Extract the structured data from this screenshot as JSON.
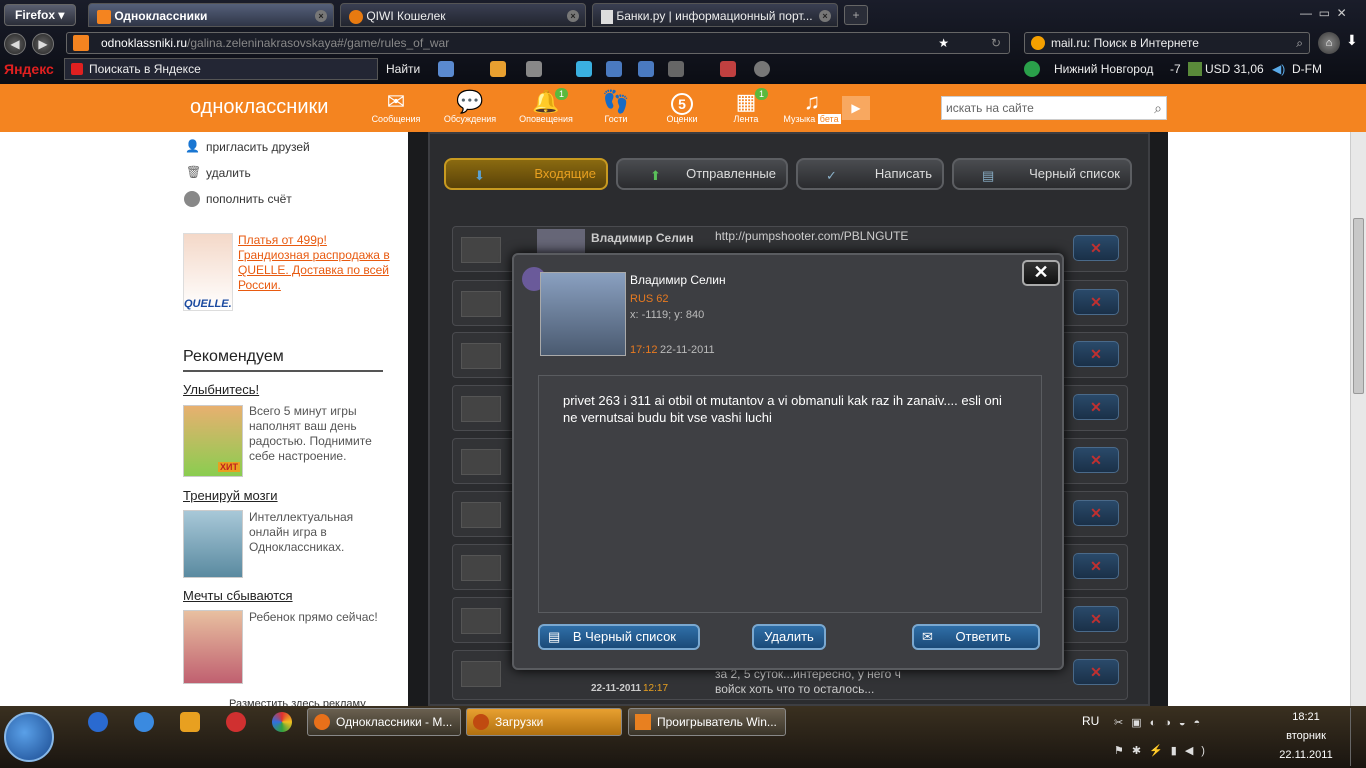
{
  "browser": {
    "firefox_label": "Firefox",
    "tabs": [
      {
        "label": "Одноклассники"
      },
      {
        "label": "QIWI Кошелек"
      },
      {
        "label": "Банки.ру | информационный порт..."
      }
    ],
    "url_domain": "odnoklassniki.ru",
    "url_path": "/galina.zeleninakrasovskaya#/game/rules_of_war",
    "search_text": "mail.ru: Поиск в Интернете",
    "yandex_logo": "Яндекс",
    "yandex_search": "Поискать в Яндексе",
    "find_label": "Найти",
    "city": "Нижний Новгород",
    "temp": "-7",
    "usd": "USD 31,06",
    "radio": "D-FM"
  },
  "site": {
    "logo": "одноклассники",
    "nav": [
      {
        "label": "Сообщения",
        "icon": "envelope-icon",
        "badge": ""
      },
      {
        "label": "Обсуждения",
        "icon": "chat-icon",
        "badge": ""
      },
      {
        "label": "Оповещения",
        "icon": "bell-icon",
        "badge": "1"
      },
      {
        "label": "Гости",
        "icon": "footprints-icon",
        "badge": ""
      },
      {
        "label": "Оценки",
        "icon": "rating-icon",
        "badge": "",
        "glyph": "5"
      },
      {
        "label": "Лента",
        "icon": "feed-icon",
        "badge": "1"
      },
      {
        "label": "Музыка",
        "icon": "music-icon",
        "badge": "",
        "tag": "бета"
      }
    ],
    "search_placeholder": "искать на сайте"
  },
  "sidebar": {
    "links": [
      "пригласить друзей",
      "удалить",
      "пополнить счёт"
    ],
    "ad_text": "Платья от 499р! Грандиозная распродажа в QUELLE. Доставка по всей России.",
    "ad_logo": "QUELLE.",
    "recommend_title": "Рекомендуем",
    "recs": [
      {
        "title": "Улыбнитесь!",
        "desc": "Всего 5 минут игры наполнят ваш день радостью. Поднимите себе настроение.",
        "badge": "ХИТ"
      },
      {
        "title": "Тренируй мозги",
        "desc": "Интеллектуальная онлайн игра в Одноклассниках."
      },
      {
        "title": "Мечты сбываются",
        "desc": "Ребенок прямо сейчас!"
      }
    ],
    "place_ad": "Разместить здесь рекламу"
  },
  "game": {
    "tabs": [
      "Входящие",
      "Отправленные",
      "Написать",
      "Черный список"
    ],
    "row1": {
      "name": "Владимир Селин",
      "text": "http://pumpshooter.com/PBLNGUTE"
    },
    "last_row": {
      "date": "22-11-2011",
      "time": "12:17",
      "text1": "за 2, 5 суток...интересно, у него ч",
      "text2": "войск хоть что то осталось..."
    }
  },
  "modal": {
    "name": "Владимир Селин",
    "country": "RUS 62",
    "coords": "x: -1119; y: 840",
    "time": "17:12",
    "date": "22-11-2011",
    "message": "privet 263   i 311 ai otbil ot mutantov a vi obmanuli kak raz ih zanaiv.... esli oni ne vernutsai budu bit vse vashi luchi",
    "btn_blacklist": "В Черный список",
    "btn_delete": "Удалить",
    "btn_reply": "Ответить"
  },
  "taskbar": {
    "tasks": [
      "Одноклассники - M...",
      "Загрузки",
      "Проигрыватель Win..."
    ],
    "lang": "RU",
    "time": "18:21",
    "day": "вторник",
    "date": "22.11.2011"
  }
}
